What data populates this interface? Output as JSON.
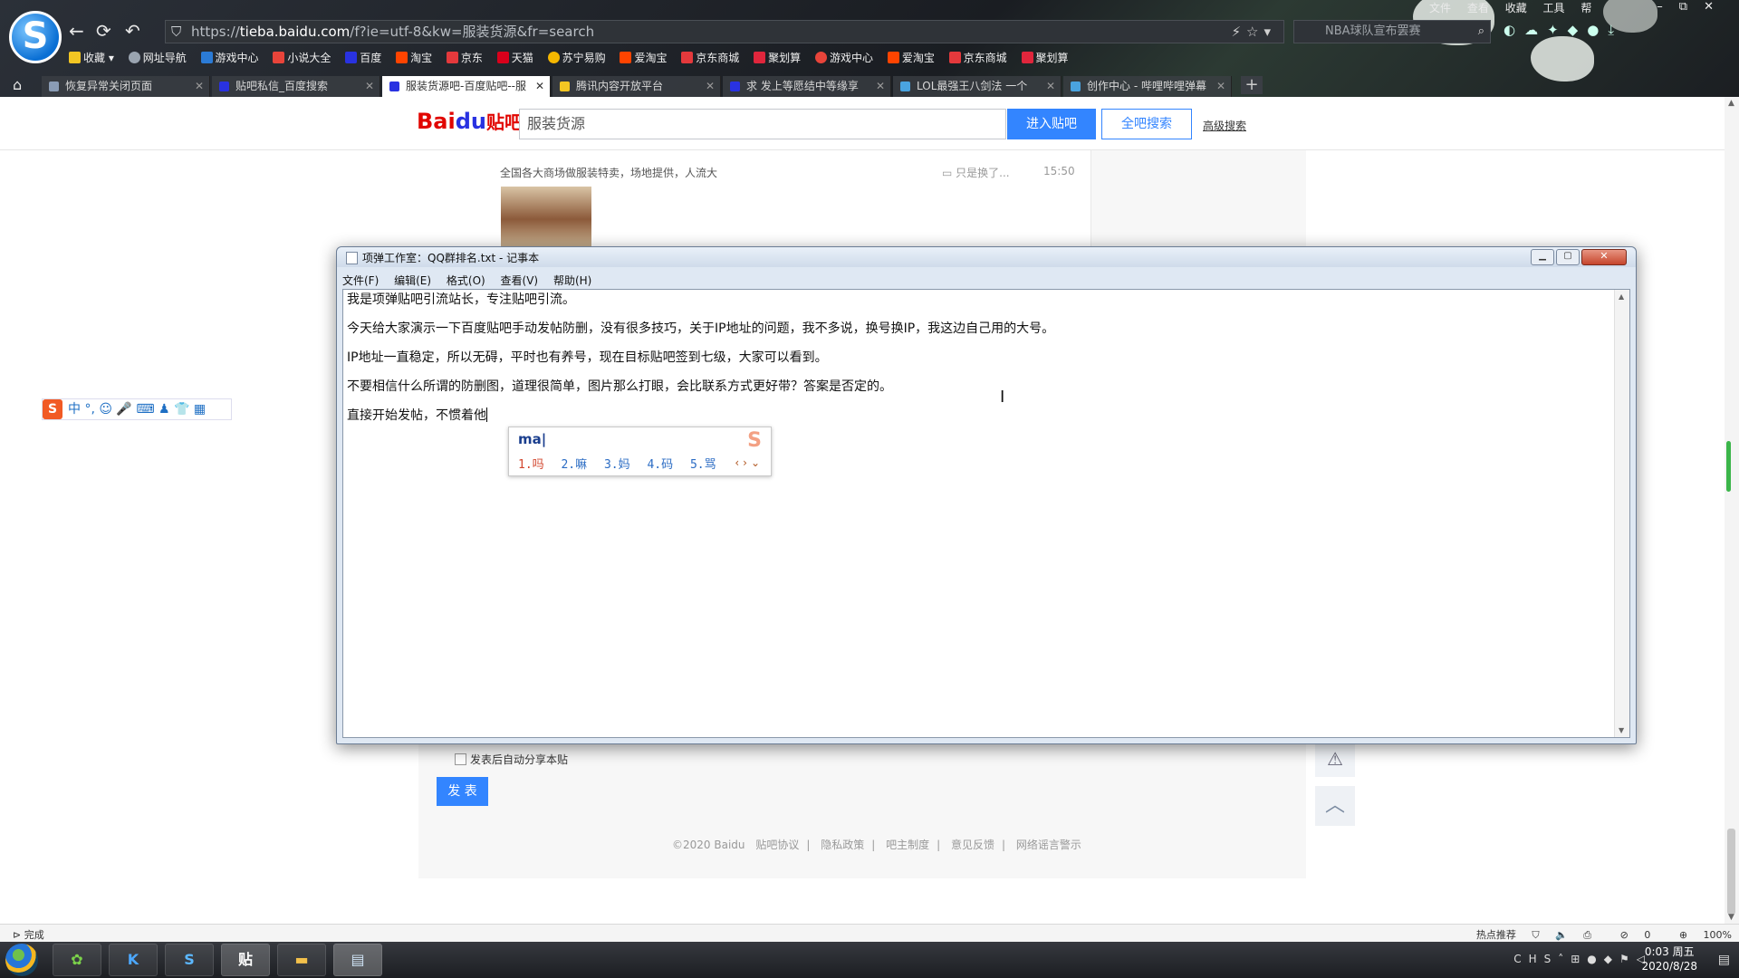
{
  "browser": {
    "url_prefix": "https://",
    "url_domain": "tieba.baidu.com",
    "url_rest": "/f?ie=utf-8&kw=服装货源&fr=search",
    "search_placeholder": "NBA球队宣布罢赛",
    "top_menu": [
      "文件",
      "查看",
      "收藏",
      "工具",
      "帮"
    ],
    "bookmarks": [
      {
        "label": "收藏",
        "color": "#f3c623"
      },
      {
        "label": "网址导航",
        "color": "#9aa4b0"
      },
      {
        "label": "游戏中心",
        "color": "#2b7bd6"
      },
      {
        "label": "小说大全",
        "color": "#e8443a"
      },
      {
        "label": "百度",
        "color": "#2932e1"
      },
      {
        "label": "淘宝",
        "color": "#f40"
      },
      {
        "label": "京东",
        "color": "#e4393c"
      },
      {
        "label": "天猫",
        "color": "#d9001b"
      },
      {
        "label": "苏宁易购",
        "color": "#f5b700"
      },
      {
        "label": "爱淘宝",
        "color": "#f40"
      },
      {
        "label": "京东商城",
        "color": "#e4393c"
      },
      {
        "label": "聚划算",
        "color": "#e0263c"
      },
      {
        "label": "游戏中心",
        "color": "#e8443a"
      },
      {
        "label": "爱淘宝",
        "color": "#f40"
      },
      {
        "label": "京东商城",
        "color": "#e4393c"
      },
      {
        "label": "聚划算",
        "color": "#e0263c"
      }
    ],
    "tabs": [
      {
        "label": "恢复异常关闭页面",
        "active": false
      },
      {
        "label": "贴吧私信_百度搜索",
        "active": false
      },
      {
        "label": "服装货源吧-百度贴吧--服",
        "active": true
      },
      {
        "label": "腾讯内容开放平台",
        "active": false
      },
      {
        "label": "求 发上等愿结中等缘享",
        "active": false
      },
      {
        "label": "LOL最强王八剑法 一个",
        "active": false
      },
      {
        "label": "创作中心 - 哔哩哔哩弹幕",
        "active": false
      }
    ]
  },
  "tieba": {
    "logo_bai": "Bai",
    "logo_paw": "du",
    "logo_tie": "贴吧",
    "search_value": "服装货源",
    "enter_label": "进入贴吧",
    "all_label": "全吧搜索",
    "advanced_label": "高级搜索",
    "thread_snippet": "全国各大商场做服装特卖，场地提供，人流大",
    "thread_reply": "只是换了...",
    "thread_time": "15:50",
    "share_label": "发表后自动分享本贴",
    "post_label": "发 表",
    "footer": [
      "©2020 Baidu",
      "贴吧协议",
      "隐私政策",
      "吧主制度",
      "意见反馈",
      "网络谣言警示"
    ]
  },
  "notepad": {
    "title": "项弹工作室：QQ群排名.txt - 记事本",
    "menu": [
      "文件(F)",
      "编辑(E)",
      "格式(O)",
      "查看(V)",
      "帮助(H)"
    ],
    "lines": [
      "我是项弹贴吧引流站长，专注贴吧引流。",
      "今天给大家演示一下百度贴吧手动发帖防删，没有很多技巧，关于IP地址的问题，我不多说，换号换IP，我这边自己用的大号。",
      "IP地址一直稳定，所以无碍，平时也有养号，现在目标贴吧签到七级，大家可以看到。",
      "不要相信什么所谓的防删图，道理很简单，图片那么打眼，会比联系方式更好带？答案是否定的。",
      "直接开始发帖，不惯着他"
    ]
  },
  "ime": {
    "pinyin": "ma",
    "candidates": [
      "1.吗",
      "2.嘛",
      "3.妈",
      "4.码",
      "5.骂"
    ],
    "toolbar": [
      "中",
      "°,",
      "☺",
      "🎤",
      "⌨",
      "♟",
      "👕",
      "▦"
    ]
  },
  "status": {
    "left": "完成",
    "right": [
      "热点推荐",
      "0",
      "100%"
    ]
  },
  "taskbar": {
    "clock_time": "0:03 周五",
    "clock_date": "2020/8/28",
    "tray_lang": "CH"
  }
}
